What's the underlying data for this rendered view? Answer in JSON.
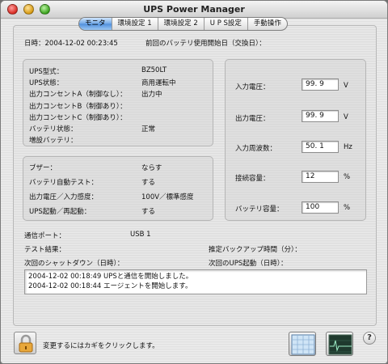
{
  "window": {
    "title": "UPS Power Manager"
  },
  "tabs": [
    {
      "label": "モニタ",
      "active": true
    },
    {
      "label": "環境設定 1",
      "active": false
    },
    {
      "label": "環境設定 2",
      "active": false
    },
    {
      "label": "U P S設定",
      "active": false
    },
    {
      "label": "手動操作",
      "active": false
    }
  ],
  "header": {
    "datetime": "日時：2004-12-02 00:23:45",
    "battery_start": "前回のバッテリ使用開始日（交換日）："
  },
  "status": {
    "items": [
      {
        "label": "UPS型式：",
        "value": "BZ50LT"
      },
      {
        "label": "UPS状態：",
        "value": "商用運転中"
      },
      {
        "label": "出力コンセントA（制御なし）：",
        "value": "出力中"
      },
      {
        "label": "出力コンセントB（制御あり）：",
        "value": ""
      },
      {
        "label": "出力コンセントC（制御あり）：",
        "value": ""
      },
      {
        "label": "バッテリ状態：",
        "value": "正常"
      },
      {
        "label": "増設バッテリ：",
        "value": ""
      }
    ]
  },
  "settings": {
    "items": [
      {
        "label": "ブザー：",
        "value": "ならす"
      },
      {
        "label": "バッテリ自動テスト：",
        "value": "する"
      },
      {
        "label": "出力電圧／入力感度：",
        "value": "100V／標準感度"
      },
      {
        "label": "UPS起動／再起動：",
        "value": "する"
      }
    ]
  },
  "measurements": [
    {
      "label": "入力電圧：",
      "value": "99. 9",
      "unit": "V"
    },
    {
      "label": "出力電圧：",
      "value": "99. 9",
      "unit": "V"
    },
    {
      "label": "入力周波数：",
      "value": "50. 1",
      "unit": "Hz"
    },
    {
      "label": "接続容量：",
      "value": "12",
      "unit": "%"
    },
    {
      "label": "バッテリ容量：",
      "value": "100",
      "unit": "%"
    }
  ],
  "info": {
    "comm_port_label": "通信ポート：",
    "comm_port_value": "USB 1",
    "test_result_label": "テスト結果：",
    "backup_time_label": "推定バックアップ時間（分）：",
    "next_shutdown_label": "次回のシャットダウン（日時）：",
    "next_startup_label": "次回のUPS起動（日時）："
  },
  "log": [
    "2004-12-02 00:18:49 UPSと通信を開始しました。",
    "2004-12-02 00:18:44 エージェントを開始します。"
  ],
  "footer": {
    "lock_hint": "変更するにはカギをクリックします。",
    "help_glyph": "?"
  }
}
